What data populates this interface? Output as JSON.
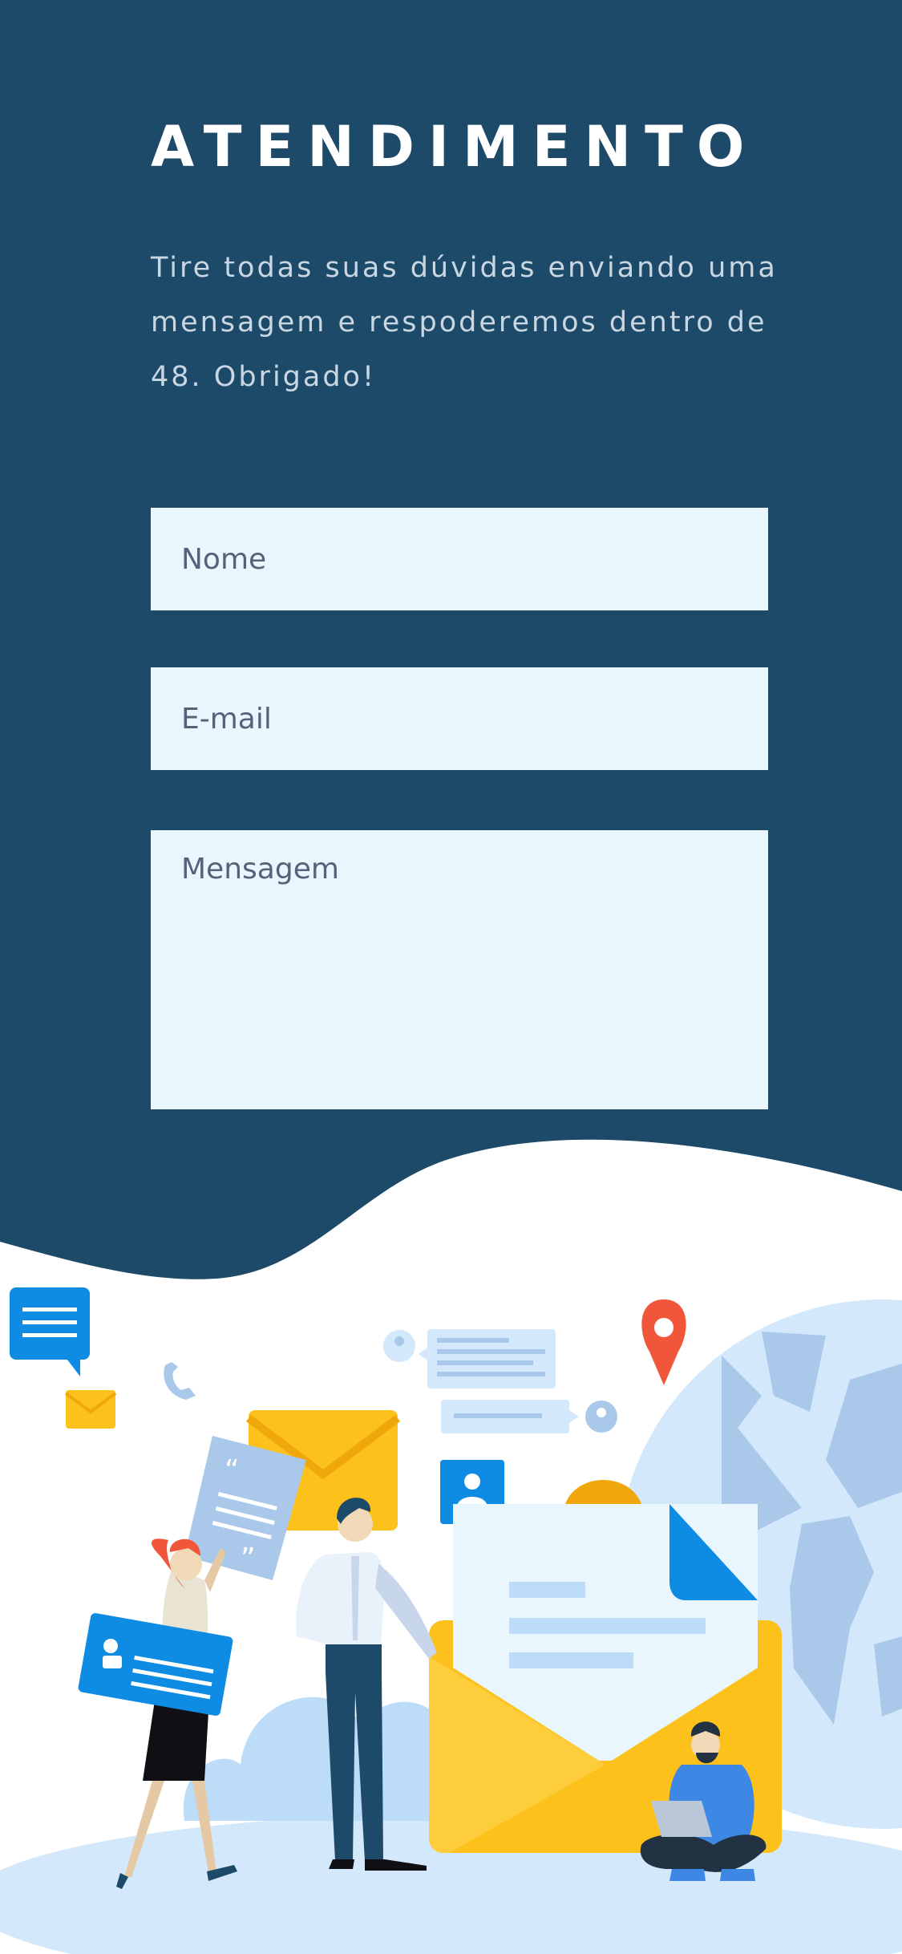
{
  "page": {
    "title": "ATENDIMENTO",
    "intro": "Tire todas suas dúvidas enviando uma mensagem e respoderemos dentro de 48. Obrigado!"
  },
  "form": {
    "name_placeholder": "Nome",
    "email_placeholder": "E-mail",
    "message_placeholder": "Mensagem"
  },
  "colors": {
    "header_bg": "#1d4a69",
    "field_bg": "#e9f6fe",
    "accent_blue": "#0e8ce4",
    "envelope_yellow": "#fcc21b",
    "pin_red": "#f1563a"
  },
  "illustration": {
    "icons": [
      "chat-bubble-icon",
      "mail-icon",
      "phone-icon",
      "location-pin-icon",
      "user-icon",
      "quote-card-icon",
      "video-card-icon",
      "globe-icon"
    ]
  }
}
